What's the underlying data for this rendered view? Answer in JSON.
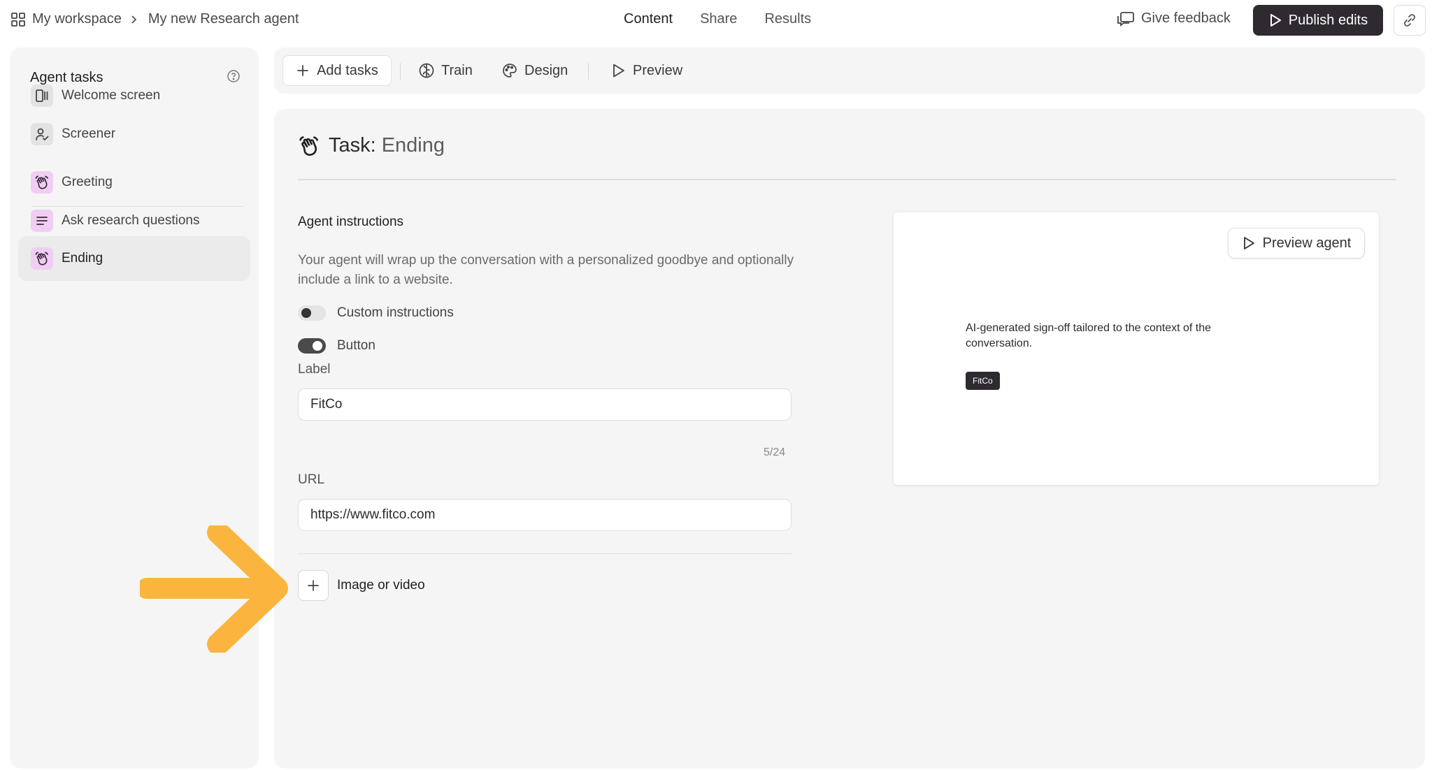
{
  "topbar": {
    "breadcrumb": {
      "workspace": "My workspace",
      "project": "My new Research agent"
    },
    "tabs": [
      {
        "label": "Content",
        "active": true
      },
      {
        "label": "Share",
        "active": false
      },
      {
        "label": "Results",
        "active": false
      }
    ],
    "feedback_label": "Give feedback",
    "publish_label": "Publish edits"
  },
  "sidebar": {
    "title": "Agent tasks",
    "items": [
      {
        "label": "Welcome screen",
        "icon": "welcome-screen-icon"
      },
      {
        "label": "Screener",
        "icon": "screener-icon"
      },
      {
        "label": "Greeting",
        "icon": "waving-hand-icon"
      },
      {
        "label": "Ask research questions",
        "icon": "lines-icon"
      },
      {
        "label": "Ending",
        "icon": "waving-hand-icon",
        "active": true
      }
    ]
  },
  "toolbar": {
    "add_tasks": "Add tasks",
    "train": "Train",
    "design": "Design",
    "preview": "Preview"
  },
  "task": {
    "prefix": "Task:",
    "name": "Ending"
  },
  "instructions": {
    "title": "Agent instructions",
    "description": "Your agent will wrap up the conversation with a personalized goodbye and optionally include a link to a website.",
    "custom_instructions_label": "Custom instructions",
    "custom_instructions_on": false,
    "button_label": "Button",
    "button_on": true
  },
  "fields": {
    "label_title": "Label",
    "label_value": "FitCo",
    "label_counter": "5/24",
    "url_title": "URL",
    "url_value": "https://www.fitco.com"
  },
  "media": {
    "add_label": "Image or video"
  },
  "preview": {
    "button_label": "Preview agent",
    "text": "AI-generated sign-off tailored to the context of the conversation.",
    "chip_label": "FitCo"
  },
  "colors": {
    "accent_dark": "#2e2a30",
    "icon_pink": "#f1cdf3",
    "arrow": "#fbb53e",
    "panel_bg": "#f5f5f5"
  }
}
